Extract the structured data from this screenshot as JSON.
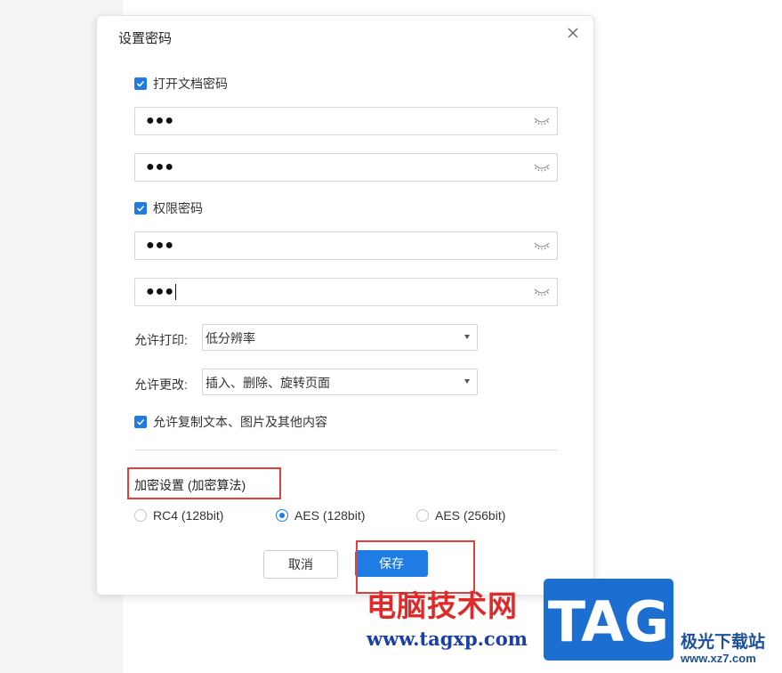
{
  "dialog": {
    "title": "设置密码",
    "open_password": {
      "label": "打开文档密码",
      "checked": true,
      "password": "●●●",
      "confirm": "●●●"
    },
    "permission_password": {
      "label": "权限密码",
      "checked": true,
      "password": "●●●",
      "confirm": "●●●"
    },
    "print": {
      "label": "允许打印:",
      "value": "低分辨率"
    },
    "modify": {
      "label": "允许更改:",
      "value": "插入、删除、旋转页面"
    },
    "copy": {
      "label": "允许复制文本、图片及其他内容",
      "checked": true
    },
    "encryption": {
      "label": "加密设置 (加密算法)",
      "options": [
        {
          "label": "RC4 (128bit)",
          "selected": false
        },
        {
          "label": "AES (128bit)",
          "selected": true
        },
        {
          "label": "AES (256bit)",
          "selected": false
        }
      ]
    },
    "cancel_label": "取消",
    "save_label": "保存"
  },
  "watermark": {
    "text": "电脑技术网",
    "url": "www.tagxp.com",
    "logo": "TAG",
    "site": "极光下载站",
    "site_url": "www.xz7.com"
  },
  "colors": {
    "accent": "#1f7ce4",
    "highlight": "#e53c3c",
    "watermark_red": "#e02a2a",
    "watermark_blue": "#1a3fa8"
  },
  "icons": {
    "close": "close-icon",
    "check": "check-icon",
    "eye": "eye-closed-icon"
  }
}
